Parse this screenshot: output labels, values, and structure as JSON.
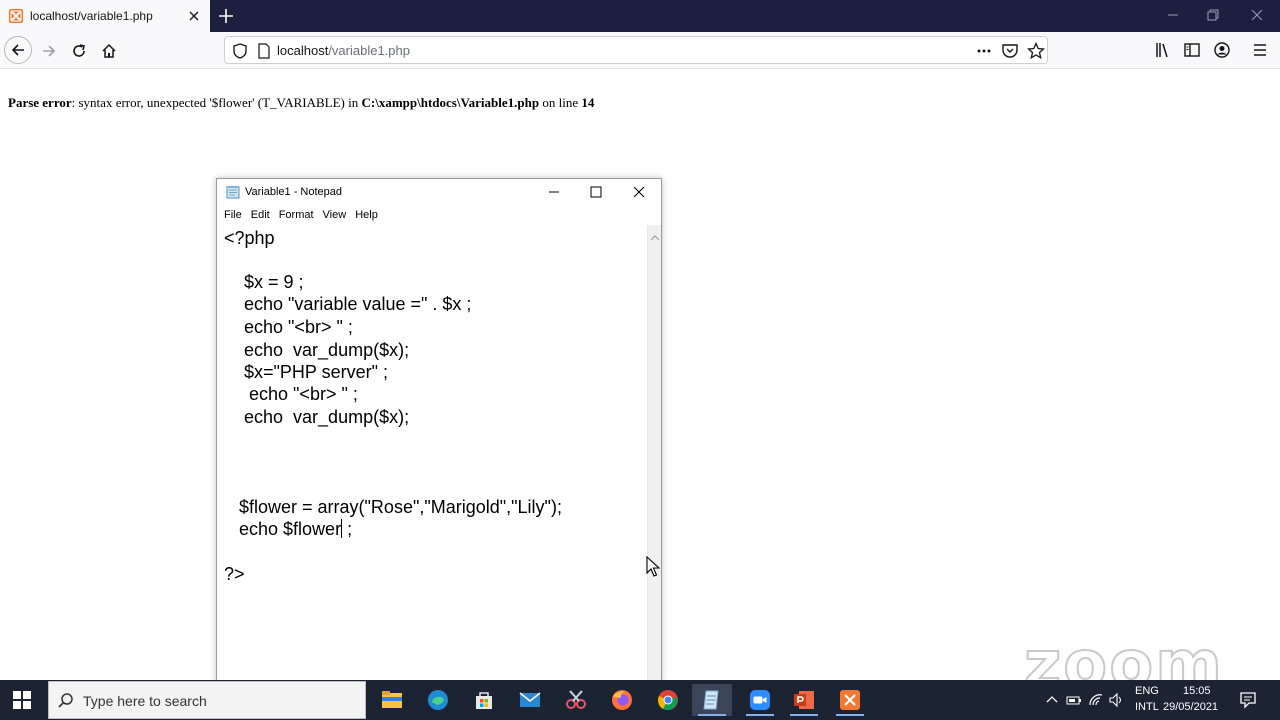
{
  "browser": {
    "tab_title": "localhost/variable1.php",
    "url_host": "localhost",
    "url_path": "/variable1.php"
  },
  "page": {
    "error_label": "Parse error",
    "error_message": ": syntax error, unexpected '$flower' (T_VARIABLE) in ",
    "error_file": "C:\\xampp\\htdocs\\Variable1.php",
    "error_on_line": " on line ",
    "error_line_number": "14"
  },
  "notepad": {
    "title": "Variable1 - Notepad",
    "menu": [
      "File",
      "Edit",
      "Format",
      "View",
      "Help"
    ],
    "code_lines": [
      "<?php",
      "",
      "    $x = 9 ;",
      "    echo \"variable value =\" . $x ;",
      "    echo \"<br> \" ;",
      "    echo  var_dump($x);",
      "    $x=\"PHP server\" ;",
      "     echo \"<br> \" ;",
      "    echo  var_dump($x);",
      "",
      "",
      "",
      "   $flower = array(\"Rose\",\"Marigold\",\"Lily\");",
      "   echo $flower",
      "",
      "?>"
    ],
    "caret_suffix": " ;"
  },
  "watermark": "zoom",
  "taskbar": {
    "search_placeholder": "Type here to search",
    "apps": [
      "file-explorer",
      "edge",
      "store",
      "mail",
      "snipping-tool",
      "firefox",
      "chrome",
      "notepad",
      "zoom",
      "powerpoint",
      "xampp"
    ],
    "lang_top": "ENG",
    "lang_bottom": "INTL",
    "time": "15:05",
    "date": "29/05/2021"
  },
  "colors": {
    "tabstrip": "#1d1f3f",
    "taskbar": "#1c2333",
    "xampp_orange": "#f07a35"
  }
}
